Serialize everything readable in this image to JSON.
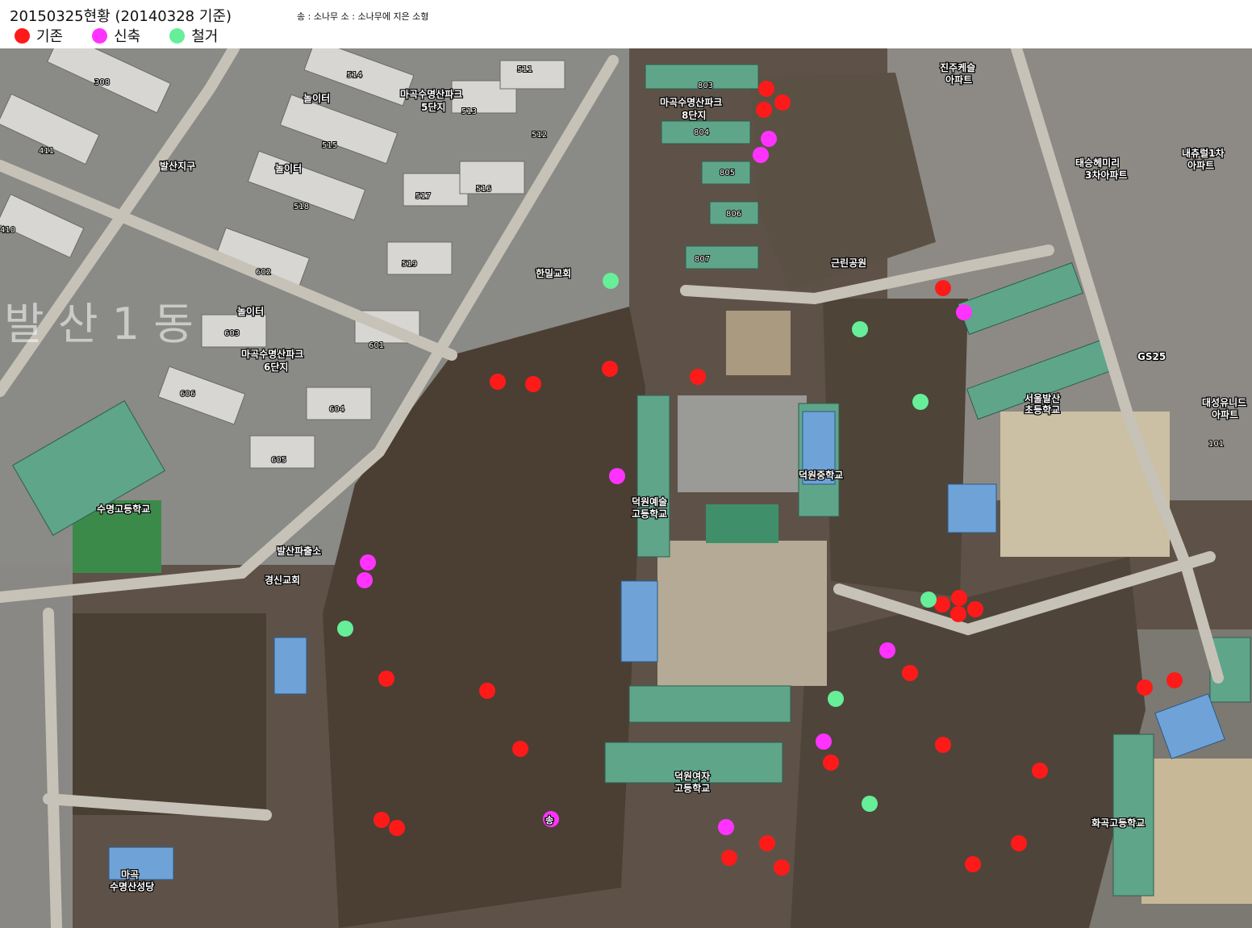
{
  "header": {
    "title": "20150325현황 (20140328 기준)",
    "note": "송 : 소나무   소 : 소나무에 지은 소형"
  },
  "legend": [
    {
      "label": "기존",
      "color": "#ff1a1a"
    },
    {
      "label": "신축",
      "color": "#ff33ff"
    },
    {
      "label": "철거",
      "color": "#66ee99"
    }
  ],
  "map": {
    "watermark": "발 산 1 동",
    "labels": {
      "park5": "마곡수명산파크",
      "park5_sub": "5단지",
      "park8": "마곡수명산파크",
      "park8_sub": "8단지",
      "park6": "마곡수명산파크",
      "park6_sub": "6단지",
      "balsan_station": "발산지구",
      "hanmil_church": "한밀교회",
      "geunrin_park": "근린공원",
      "jinju_apt": "진주케슬",
      "jinju_apt_sub": "아파트",
      "taeseung_apt": "태승헤미리",
      "taeseung_apt_sub": "3차아파트",
      "naechu_apt": "내츄럴1차",
      "naechu_apt_sub": "아파트",
      "daesung_apt": "대성유니드",
      "daesung_apt_sub": "아파트",
      "seoul_balsan_school": "서울발산",
      "seoul_balsan_school_sub": "초등학교",
      "suyeong_high": "수명고등학교",
      "deokwon_art": "덕원예술",
      "deokwon_art_sub": "고등학교",
      "deokwon_middle": "덕원중학교",
      "deokwon_girls": "덕원여자",
      "deokwon_girls_sub": "고등학교",
      "balsan_police": "발산파출소",
      "gyeongsin_church": "경신교회",
      "magok_cathedral": "마곡",
      "magok_cathedral_sub": "수명산성당",
      "hwagok_high": "화곡고등학교",
      "playground1": "놀이터",
      "playground2": "놀이터",
      "playground3": "놀이터",
      "gs25": "GS25",
      "song": "송"
    },
    "buildings": [
      "308",
      "411",
      "410",
      "514",
      "513",
      "511",
      "512",
      "515",
      "518",
      "517",
      "516",
      "519",
      "602",
      "603",
      "601",
      "606",
      "604",
      "605",
      "803",
      "804",
      "805",
      "806",
      "807",
      "101"
    ],
    "markers": {
      "existing": [
        [
          950,
          110
        ],
        [
          970,
          127
        ],
        [
          947,
          136
        ],
        [
          617,
          473
        ],
        [
          661,
          476
        ],
        [
          756,
          457
        ],
        [
          865,
          467
        ],
        [
          1169,
          357
        ],
        [
          1168,
          749
        ],
        [
          1189,
          741
        ],
        [
          1188,
          761
        ],
        [
          1209,
          755
        ],
        [
          1128,
          834
        ],
        [
          1419,
          852
        ],
        [
          1456,
          843
        ],
        [
          479,
          841
        ],
        [
          604,
          856
        ],
        [
          645,
          928
        ],
        [
          1030,
          945
        ],
        [
          1169,
          923
        ],
        [
          1289,
          955
        ],
        [
          473,
          1016
        ],
        [
          492,
          1026
        ],
        [
          951,
          1045
        ],
        [
          904,
          1063
        ],
        [
          969,
          1075
        ],
        [
          1263,
          1045
        ],
        [
          1206,
          1071
        ]
      ],
      "new": [
        [
          953,
          172
        ],
        [
          943,
          192
        ],
        [
          1195,
          387
        ],
        [
          765,
          590
        ],
        [
          456,
          697
        ],
        [
          452,
          719
        ],
        [
          1100,
          806
        ],
        [
          1021,
          919
        ],
        [
          900,
          1025
        ],
        [
          683,
          1015
        ]
      ],
      "removed": [
        [
          757,
          348
        ],
        [
          1066,
          408
        ],
        [
          1141,
          498
        ],
        [
          428,
          779
        ],
        [
          1151,
          743
        ],
        [
          1036,
          866
        ],
        [
          1078,
          996
        ]
      ]
    }
  }
}
